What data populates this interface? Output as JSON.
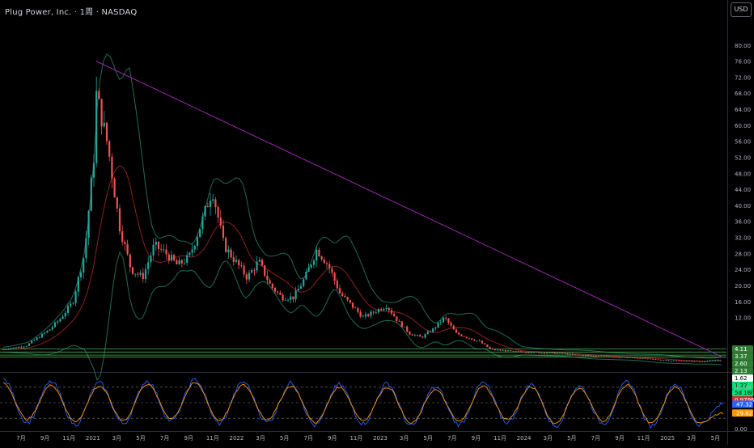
{
  "header": {
    "title": "Plug Power, Inc. · 1周 · NASDAQ",
    "currency_button": "USD"
  },
  "colors": {
    "up": "#26a69a",
    "down": "#ef5350",
    "bb_band": "#1e6b52",
    "bb_mid": "#8b2222",
    "trendline": "#9c27b0",
    "stoch_k": "#2962ff",
    "stoch_d": "#ff9800",
    "support": "#4caf50",
    "axis_text": "#b2b5be",
    "badge_green": "#2e7d32",
    "badge_bright": "#00e676",
    "badge_red": "#d32f2f",
    "badge_white": "#ffffff"
  },
  "chart_data": [
    {
      "type": "candlestick",
      "title": "Plug Power, Inc. · 1周 · NASDAQ",
      "ylim": [
        0,
        84
      ],
      "y_ticks": [
        "80.00",
        "76.00",
        "72.00",
        "68.00",
        "64.00",
        "60.00",
        "56.00",
        "52.00",
        "48.00",
        "44.00",
        "40.00",
        "36.00",
        "32.00",
        "28.00",
        "24.00",
        "20.00",
        "16.00",
        "12.00"
      ],
      "x_ticks": [
        "7月",
        "9月",
        "11月",
        "2021",
        "3月",
        "5月",
        "7月",
        "9月",
        "11月",
        "2022",
        "3月",
        "5月",
        "7月",
        "9月",
        "11月",
        "2023",
        "3月",
        "5月",
        "7月",
        "9月",
        "11月",
        "2024",
        "3月",
        "5月",
        "7月",
        "9月",
        "11月",
        "2025",
        "3月",
        "5月"
      ],
      "x_range": [
        "2020-05",
        "2025-07"
      ],
      "close_path": [
        [
          "2020-05",
          4.0
        ],
        [
          "2020-07",
          5.0
        ],
        [
          "2020-08",
          7.0
        ],
        [
          "2020-09",
          9.0
        ],
        [
          "2020-10",
          12.0
        ],
        [
          "2020-11",
          16.0
        ],
        [
          "2020-12",
          28.0
        ],
        [
          "2021-01",
          58.0
        ],
        [
          "2021-01",
          68.0
        ],
        [
          "2021-02",
          55.0
        ],
        [
          "2021-03",
          35.0
        ],
        [
          "2021-04",
          24.0
        ],
        [
          "2021-05",
          22.0
        ],
        [
          "2021-06",
          30.0
        ],
        [
          "2021-07",
          28.0
        ],
        [
          "2021-08",
          25.0
        ],
        [
          "2021-09",
          27.0
        ],
        [
          "2021-10",
          35.0
        ],
        [
          "2021-11",
          44.0
        ],
        [
          "2021-12",
          30.0
        ],
        [
          "2022-01",
          26.0
        ],
        [
          "2022-02",
          22.0
        ],
        [
          "2022-03",
          26.0
        ],
        [
          "2022-04",
          20.0
        ],
        [
          "2022-05",
          17.0
        ],
        [
          "2022-06",
          17.0
        ],
        [
          "2022-07",
          22.0
        ],
        [
          "2022-08",
          29.0
        ],
        [
          "2022-09",
          25.0
        ],
        [
          "2022-10",
          18.0
        ],
        [
          "2022-11",
          15.0
        ],
        [
          "2022-12",
          12.0
        ],
        [
          "2023-02",
          15.0
        ],
        [
          "2023-03",
          11.0
        ],
        [
          "2023-04",
          8.0
        ],
        [
          "2023-05",
          7.0
        ],
        [
          "2023-06",
          9.0
        ],
        [
          "2023-07",
          12.0
        ],
        [
          "2023-08",
          8.0
        ],
        [
          "2023-09",
          7.0
        ],
        [
          "2023-10",
          6.0
        ],
        [
          "2023-11",
          4.0
        ],
        [
          "2024-01",
          3.5
        ],
        [
          "2024-03",
          3.2
        ],
        [
          "2024-05",
          3.0
        ],
        [
          "2024-07",
          2.5
        ],
        [
          "2024-09",
          2.2
        ],
        [
          "2024-11",
          2.0
        ],
        [
          "2025-01",
          1.5
        ],
        [
          "2025-03",
          1.2
        ],
        [
          "2025-05",
          0.98
        ],
        [
          "2025-06",
          1.22
        ],
        [
          "2025-07",
          1.62
        ]
      ],
      "indicators": [
        "Bollinger Bands (upper, middle, lower)"
      ],
      "trendline": {
        "from": [
          "2021-01",
          76.0
        ],
        "to": [
          "2025-07",
          2.0
        ]
      },
      "support_levels": [
        4.11,
        3.37,
        2.6,
        2.13
      ],
      "price_labels": [
        {
          "text": "4.11",
          "value": 4.11,
          "style": "green"
        },
        {
          "text": "3.37",
          "value": 3.37,
          "style": "green"
        },
        {
          "text": "2.60",
          "value": 2.6,
          "style": "green"
        },
        {
          "text": "2.13",
          "value": 2.13,
          "style": "green"
        },
        {
          "text": "1.62",
          "value": 1.62,
          "style": "white"
        },
        {
          "text": "1.22",
          "value": 1.22,
          "style": "bright"
        },
        {
          "text": "5d 16h",
          "value": 0.8,
          "style": "bright"
        },
        {
          "text": "0.9796",
          "value": 0.9796,
          "style": "red"
        }
      ]
    },
    {
      "type": "line",
      "title": "",
      "ylim": [
        0,
        100
      ],
      "y_ticks": [
        "80.00",
        "0.00"
      ],
      "x_range": [
        "2020-05",
        "2025-07"
      ],
      "series": [
        {
          "color": "#2962ff",
          "last_label": "47.32",
          "peaks": [
            95,
            12,
            90,
            8,
            88,
            10,
            92,
            15,
            94,
            10,
            90,
            12,
            88,
            6,
            85,
            10,
            87,
            5,
            80,
            8,
            88,
            12,
            85,
            5,
            82,
            10,
            90,
            5,
            86,
            8,
            47
          ]
        },
        {
          "color": "#ff9800",
          "last_label": "29.82",
          "peaks": [
            88,
            18,
            84,
            14,
            82,
            16,
            86,
            20,
            88,
            16,
            84,
            18,
            82,
            12,
            80,
            16,
            80,
            10,
            75,
            14,
            82,
            18,
            80,
            10,
            78,
            15,
            84,
            10,
            80,
            12,
            30
          ]
        }
      ],
      "reference_lines": [
        80,
        50,
        20
      ]
    }
  ]
}
